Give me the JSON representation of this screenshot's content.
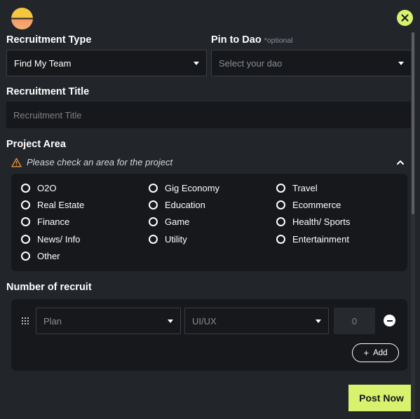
{
  "recruitment_type": {
    "label": "Recruitment Type",
    "value": "Find My Team"
  },
  "pin_to_dao": {
    "label": "Pin to Dao",
    "optional": "*optional",
    "placeholder": "Select your dao"
  },
  "recruitment_title": {
    "label": "Recruitment Title",
    "placeholder": "Recruitment Title"
  },
  "project_area": {
    "label": "Project Area",
    "warning": "Please check an area for the project",
    "options": [
      "O2O",
      "Gig Economy",
      "Travel",
      "Real Estate",
      "Education",
      "Ecommerce",
      "Finance",
      "Game",
      "Health/ Sports",
      "News/ Info",
      "Utility",
      "Entertainment",
      "Other"
    ]
  },
  "number_of_recruit": {
    "label": "Number of recruit",
    "row": {
      "category_placeholder": "Plan",
      "role_placeholder": "UI/UX",
      "count": "0"
    },
    "add_label": "Add"
  },
  "actions": {
    "post_label": "Post Now"
  },
  "colors": {
    "accent": "#d8f26e",
    "background": "#22252a",
    "field": "#16181b"
  }
}
